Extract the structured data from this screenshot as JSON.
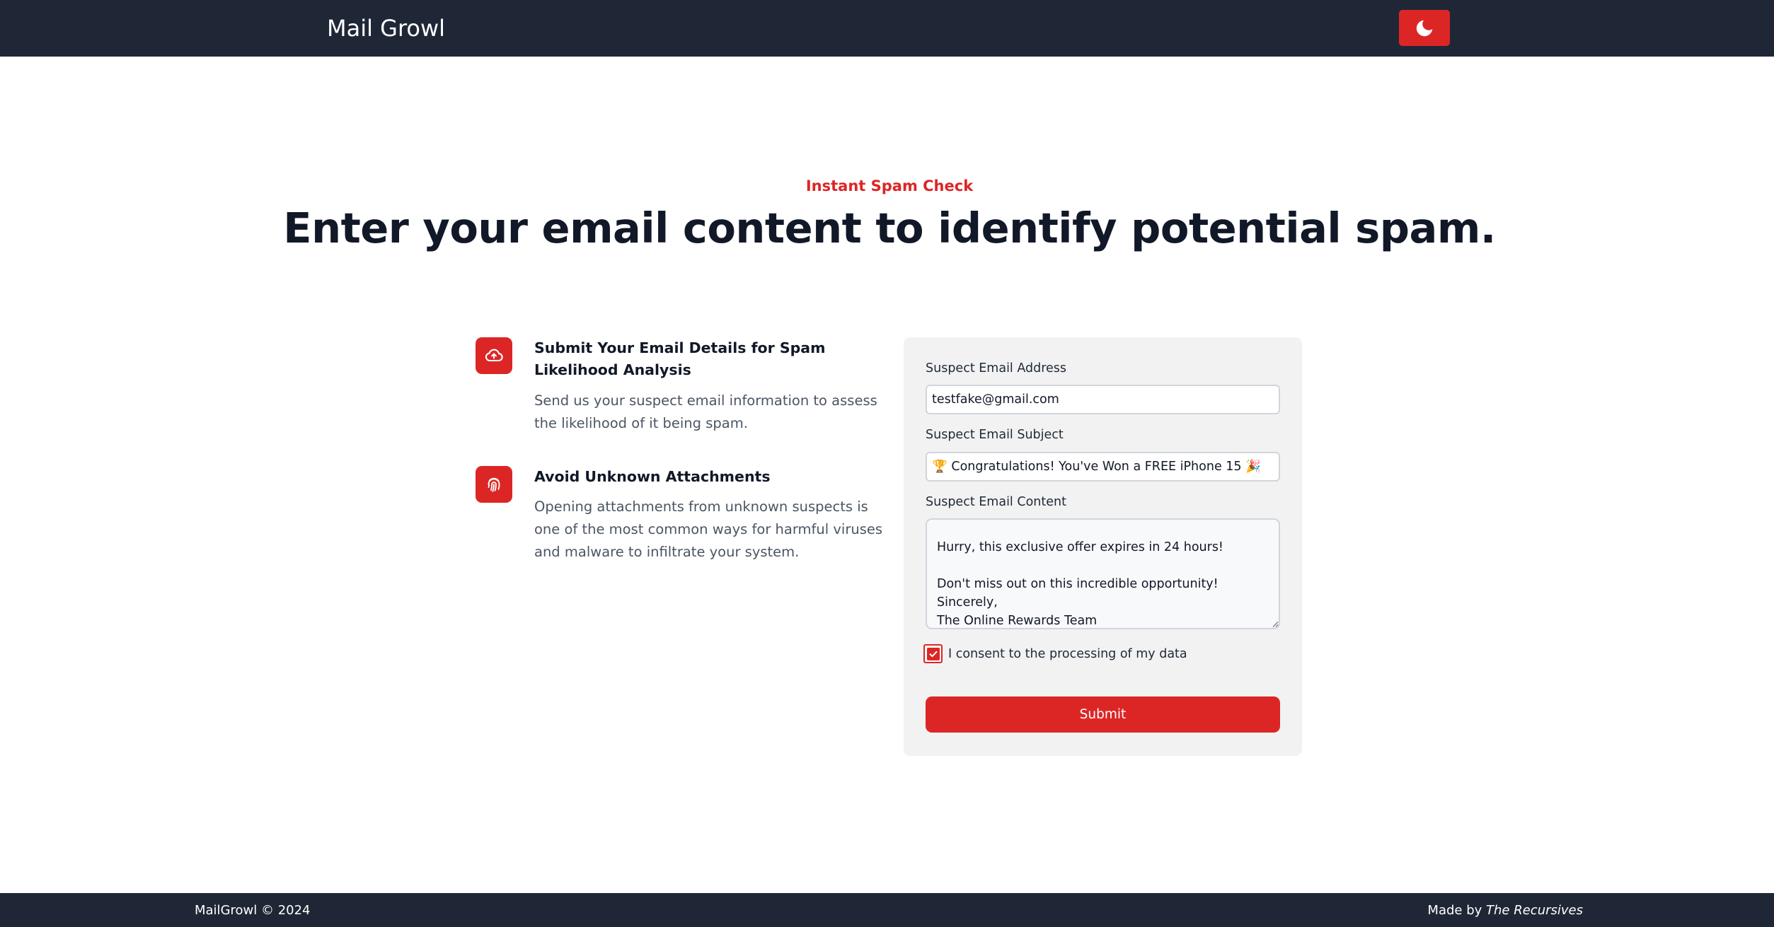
{
  "nav": {
    "brand": "Mail Growl",
    "theme_toggle_icon": "moon-icon",
    "accent": "#dc2626",
    "background": "#1f2737"
  },
  "hero": {
    "eyebrow": "Instant Spam Check",
    "title": "Enter your email content to identify potential spam."
  },
  "features": [
    {
      "icon": "cloud-upload-icon",
      "title": "Submit Your Email Details for Spam Likelihood Analysis",
      "description": "Send us your suspect email information to assess the likelihood of it being spam."
    },
    {
      "icon": "fingerprint-icon",
      "title": "Avoid Unknown Attachments",
      "description": "Opening attachments from unknown suspects is one of the most common ways for harmful viruses and malware to infiltrate your system."
    }
  ],
  "form": {
    "email_label": "Suspect Email Address",
    "email_value": "testfake@gmail.com",
    "subject_label": "Suspect Email Subject",
    "subject_value": "🏆 Congratulations! You've Won a FREE iPhone 15 🎉",
    "content_label": "Suspect Email Content",
    "content_value": "\nHurry, this exclusive offer expires in 24 hours!\n\nDon't miss out on this incredible opportunity!\nSincerely,\nThe Online Rewards Team",
    "consent_label": "I consent to the processing of my data",
    "consent_checked": true,
    "submit_label": "Submit"
  },
  "footer": {
    "copyright": "MailGrowl © 2024",
    "made_by_prefix": "Made by",
    "made_by_name": "The Recursives"
  }
}
